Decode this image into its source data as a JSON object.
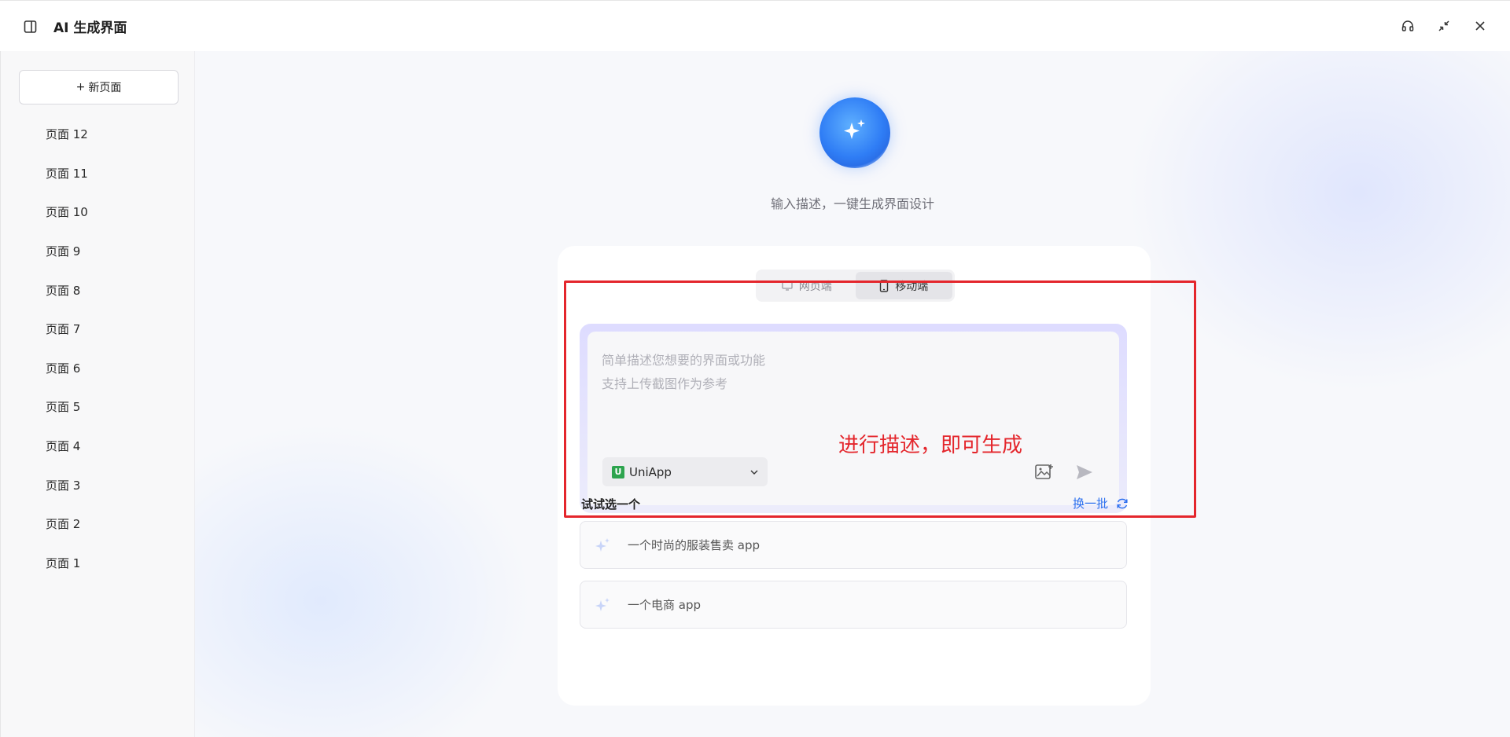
{
  "header": {
    "title": "AI 生成界面"
  },
  "sidebar": {
    "new_page_label": "新页面",
    "pages": [
      "页面 12",
      "页面 11",
      "页面 10",
      "页面 9",
      "页面 8",
      "页面 7",
      "页面 6",
      "页面 5",
      "页面 4",
      "页面 3",
      "页面 2",
      "页面 1"
    ]
  },
  "main": {
    "tagline": "输入描述，一键生成界面设计",
    "tabs": [
      {
        "label": "网页端",
        "icon": "monitor-icon",
        "active": false
      },
      {
        "label": "移动端",
        "icon": "mobile-icon",
        "active": true
      }
    ],
    "prompt": {
      "value": "",
      "placeholder": "简单描述您想要的界面或功能\n支持上传截图作为参考"
    },
    "framework": {
      "selected": "UniApp",
      "logo_letter": "U"
    },
    "annotation": "进行描述，即可生成",
    "suggestions": {
      "title": "试试选一个",
      "refresh_label": "换一批",
      "items": [
        "一个时尚的服装售卖 app",
        "一个电商 app"
      ]
    }
  },
  "colors": {
    "accent": "#2b6fef",
    "annotation_red": "#e4262c",
    "framework_green": "#2da44e"
  }
}
